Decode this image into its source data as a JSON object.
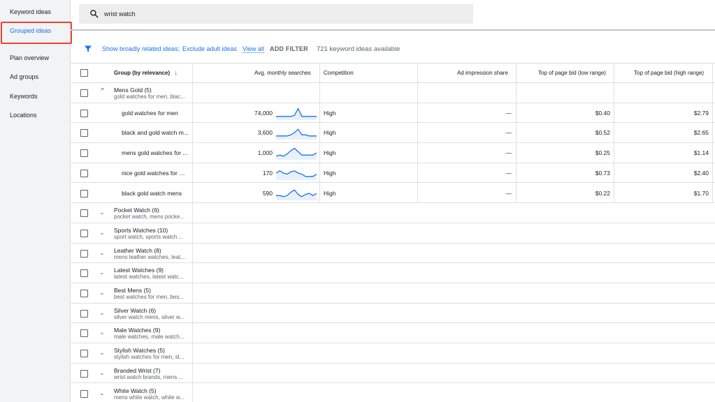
{
  "sidebar": {
    "items": [
      {
        "label": "Keyword ideas",
        "active": false
      },
      {
        "label": "Grouped ideas",
        "active": true
      },
      {
        "label": "Plan overview",
        "active": false
      },
      {
        "label": "Ad groups",
        "active": false
      },
      {
        "label": "Keywords",
        "active": false
      },
      {
        "label": "Locations",
        "active": false
      }
    ]
  },
  "search": {
    "value": "wrist watch",
    "icon": "search-icon"
  },
  "filters": {
    "link1": "Show broadly related ideas;",
    "link2": "Exclude adult ideas",
    "view_all": "View all",
    "add_filter": "ADD FILTER",
    "count_text": "721 keyword ideas available"
  },
  "table": {
    "headers": {
      "group": "Group (by relevance)",
      "searches": "Avg. monthly searches",
      "competition": "Competition",
      "impression": "Ad impression share",
      "bid_low": "Top of page bid (low range)",
      "bid_high": "Top of page bid (high range)"
    },
    "expanded_group": {
      "name": "Mens Gold (5)",
      "sub": "gold watches for men, blac..."
    },
    "keywords": [
      {
        "keyword": "gold watches for men",
        "searches": "74,000",
        "trend": [
          2,
          2,
          2,
          2,
          2,
          3,
          9,
          2,
          2,
          2,
          2,
          2
        ],
        "competition": "High",
        "impression": "—",
        "bid_low": "$0.40",
        "bid_high": "$2.79"
      },
      {
        "keyword": "black and gold watch m...",
        "searches": "3,600",
        "trend": [
          2,
          2,
          2,
          2,
          3,
          5,
          8,
          3,
          3,
          2,
          2,
          2
        ],
        "competition": "High",
        "impression": "—",
        "bid_low": "$0.52",
        "bid_high": "$2.65"
      },
      {
        "keyword": "mens gold watches for ...",
        "searches": "1,000",
        "trend": [
          2,
          3,
          2,
          4,
          7,
          9,
          6,
          3,
          3,
          3,
          3,
          5
        ],
        "competition": "High",
        "impression": "—",
        "bid_low": "$0.25",
        "bid_high": "$1.14"
      },
      {
        "keyword": "nice gold watches for m...",
        "searches": "170",
        "trend": [
          5,
          7,
          5,
          4,
          6,
          7,
          5,
          4,
          2,
          2,
          2,
          4
        ],
        "competition": "High",
        "impression": "—",
        "bid_low": "$0.73",
        "bid_high": "$2.40"
      },
      {
        "keyword": "black gold watch mens",
        "searches": "590",
        "trend": [
          3,
          3,
          2,
          3,
          6,
          8,
          4,
          2,
          4,
          5,
          3,
          5
        ],
        "competition": "High",
        "impression": "—",
        "bid_low": "$0.22",
        "bid_high": "$1.70"
      }
    ],
    "groups": [
      {
        "name": "Pocket Watch (6)",
        "sub": "pocket watch, mens pocke..."
      },
      {
        "name": "Sports Watches (10)",
        "sub": "sport watch, sports watch ..."
      },
      {
        "name": "Leather Watch (8)",
        "sub": "mens leather watches, leat..."
      },
      {
        "name": "Latest Watches (9)",
        "sub": "latest watches, latest watc..."
      },
      {
        "name": "Best Mens (5)",
        "sub": "best watches for men, bes..."
      },
      {
        "name": "Silver Watch (6)",
        "sub": "silver watch mens, silver w..."
      },
      {
        "name": "Male Watches (9)",
        "sub": "male watches, male watch..."
      },
      {
        "name": "Stylish Watches (5)",
        "sub": "stylish watches for men, st..."
      },
      {
        "name": "Branded Wrist (7)",
        "sub": "wrist watch brands, mens ..."
      },
      {
        "name": "White Watch (5)",
        "sub": "mens white watch, white w..."
      }
    ]
  },
  "colors": {
    "accent": "#1a73e8",
    "highlight_border": "#ea4335",
    "sparkline": "#1a73e8"
  }
}
